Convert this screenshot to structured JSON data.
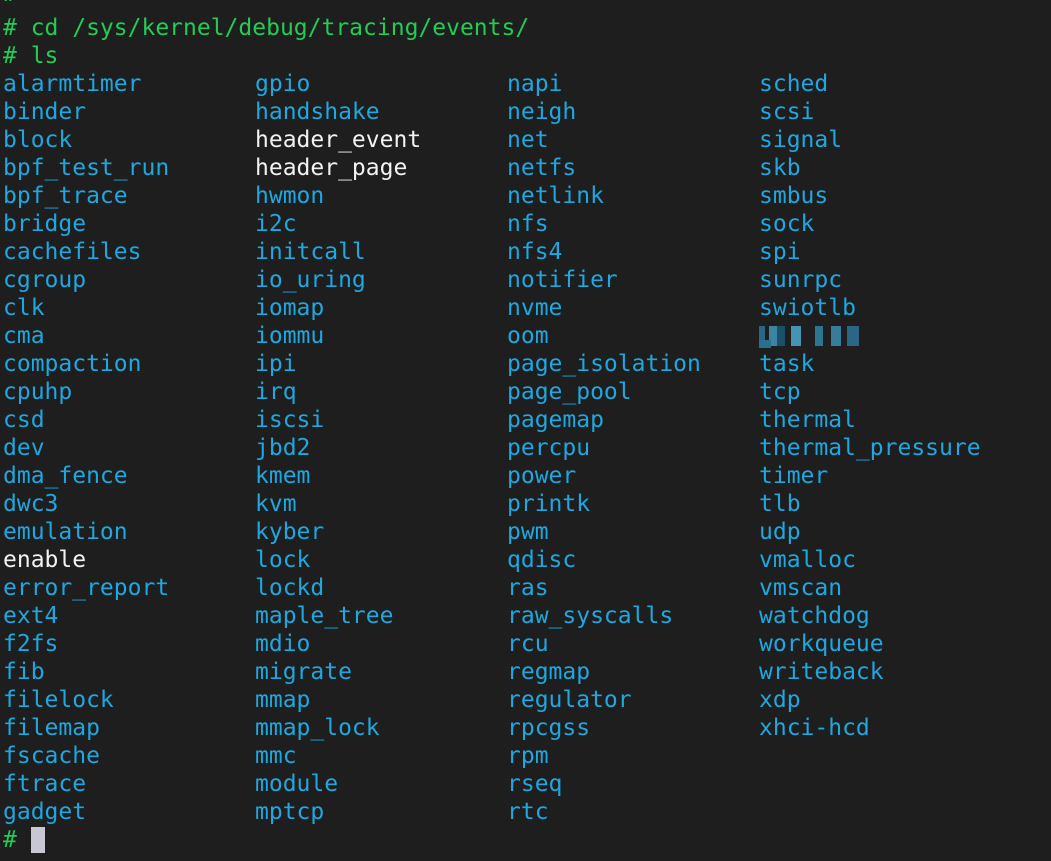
{
  "terminal": {
    "scrolled_line": "#",
    "lines": [
      "# cd /sys/kernel/debug/tracing/events/",
      "# ls"
    ],
    "final_prompt": "# ",
    "colors": {
      "background": "#1e1e1e",
      "prompt": "#22cc55",
      "directory": "#1fa7e0",
      "file": "#f2f2f2",
      "cursor": "#c8c8d4"
    }
  },
  "listing": {
    "columns": [
      [
        "alarmtimer",
        "binder",
        "block",
        "bpf_test_run",
        "bpf_trace",
        "bridge",
        "cachefiles",
        "cgroup",
        "clk",
        "cma",
        "compaction",
        "cpuhp",
        "csd",
        "dev",
        "dma_fence",
        "dwc3",
        "emulation",
        "enable",
        "error_report",
        "ext4",
        "f2fs",
        "fib",
        "filelock",
        "filemap",
        "fscache",
        "ftrace",
        "gadget"
      ],
      [
        "gpio",
        "handshake",
        "header_event",
        "header_page",
        "hwmon",
        "i2c",
        "initcall",
        "io_uring",
        "iomap",
        "iommu",
        "ipi",
        "irq",
        "iscsi",
        "jbd2",
        "kmem",
        "kvm",
        "kyber",
        "lock",
        "lockd",
        "maple_tree",
        "mdio",
        "migrate",
        "mmap",
        "mmap_lock",
        "mmc",
        "module",
        "mptcp"
      ],
      [
        "napi",
        "neigh",
        "net",
        "netfs",
        "netlink",
        "nfs",
        "nfs4",
        "notifier",
        "nvme",
        "oom",
        "page_isolation",
        "page_pool",
        "pagemap",
        "percpu",
        "power",
        "printk",
        "pwm",
        "qdisc",
        "ras",
        "raw_syscalls",
        "rcu",
        "regmap",
        "regulator",
        "rpcgss",
        "rpm",
        "rseq",
        "rtc"
      ],
      [
        "sched",
        "scsi",
        "signal",
        "skb",
        "smbus",
        "sock",
        "spi",
        "sunrpc",
        "swiotlb",
        "",
        "task",
        "tcp",
        "thermal",
        "thermal_pressure",
        "timer",
        "tlb",
        "udp",
        "vmalloc",
        "vmscan",
        "watchdog",
        "workqueue",
        "writeback",
        "xdp",
        "xhci-hcd"
      ]
    ],
    "files": [
      "enable",
      "header_event",
      "header_page"
    ],
    "redacted_entries": [
      [
        3,
        9
      ]
    ]
  }
}
